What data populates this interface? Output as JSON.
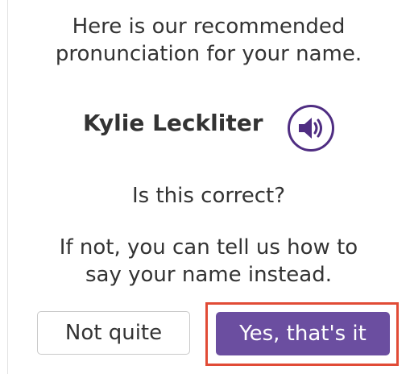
{
  "prompt": {
    "line1": "Here is our recommended",
    "line2": "pronunciation for your name."
  },
  "name": "Kylie Leckliter",
  "audio": {
    "icon": "speaker-icon",
    "color": "#4f2d82"
  },
  "question": "Is this correct?",
  "alternative": {
    "line1": "If not, you can tell us how to",
    "line2": "say your name instead."
  },
  "buttons": {
    "decline_label": "Not quite",
    "confirm_label": "Yes, that's it"
  },
  "colors": {
    "primary": "#6b4ea0",
    "highlight": "#e14b36",
    "text": "#333333"
  }
}
